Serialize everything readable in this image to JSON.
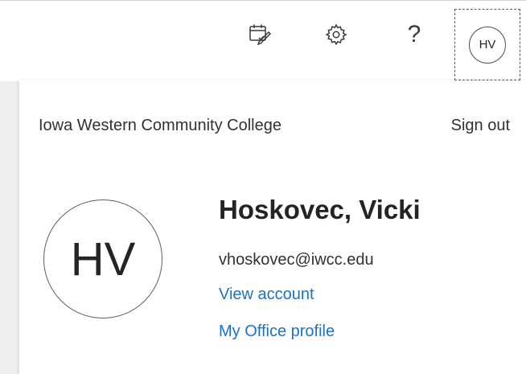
{
  "header": {
    "icons": {
      "calendar": "calendar-check-icon",
      "settings": "gear-icon",
      "help": "help-icon"
    },
    "help_glyph": "?",
    "avatar_initials": "HV"
  },
  "account_panel": {
    "organization": "Iowa Western Community College",
    "sign_out_label": "Sign out",
    "avatar_initials": "HV",
    "display_name": "Hoskovec, Vicki",
    "email": "vhoskovec@iwcc.edu",
    "view_account_label": "View account",
    "office_profile_label": "My Office profile"
  },
  "colors": {
    "link": "#1a73c8",
    "text": "#252423"
  }
}
